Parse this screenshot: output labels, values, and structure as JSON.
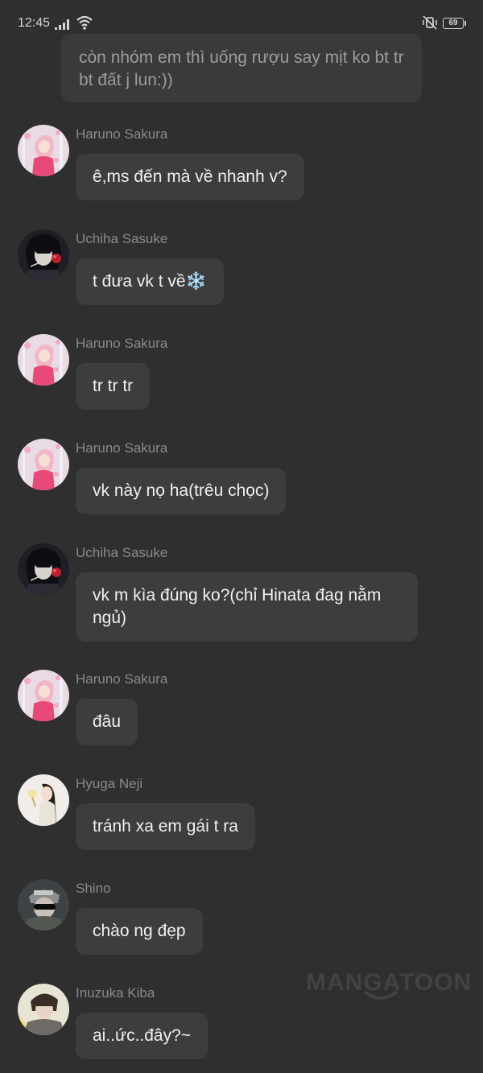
{
  "status_bar": {
    "time": "12:45",
    "battery": "69",
    "icons": [
      "signal-icon",
      "wifi-icon",
      "mute-icon",
      "battery-icon"
    ]
  },
  "narration": "còn nhóm em thì uống rượu say mịt ko bt tr bt đất j lun:))",
  "messages": [
    {
      "name": "Haruno Sakura",
      "text": "ê,ms đến mà về nhanh v?",
      "avatar": "sakura"
    },
    {
      "name": "Uchiha Sasuke",
      "text": "t đưa vk t về❄️",
      "avatar": "sasuke"
    },
    {
      "name": "Haruno Sakura",
      "text": "tr tr tr",
      "avatar": "sakura"
    },
    {
      "name": "Haruno Sakura",
      "text": "vk này nọ ha(trêu chọc)",
      "avatar": "sakura"
    },
    {
      "name": "Uchiha Sasuke",
      "text": "vk m kìa đúng ko?(chỉ Hinata đag nằm ngủ)",
      "avatar": "sasuke"
    },
    {
      "name": "Haruno Sakura",
      "text": "đâu",
      "avatar": "sakura"
    },
    {
      "name": "Hyuga Neji",
      "text": "tránh xa em gái t ra",
      "avatar": "neji"
    },
    {
      "name": "Shino",
      "text": "chào ng đẹp",
      "avatar": "shino"
    },
    {
      "name": "Inuzuka Kiba",
      "text": "ai..ức..đây?~",
      "avatar": "kiba"
    }
  ],
  "watermark": "MANGATOON",
  "colors": {
    "background": "#2f2f2f",
    "bubble": "#3d3d3d",
    "narration_bubble": "#3a3a3a",
    "name_text": "#8a8a8a",
    "bubble_text": "#f0f0f0"
  }
}
